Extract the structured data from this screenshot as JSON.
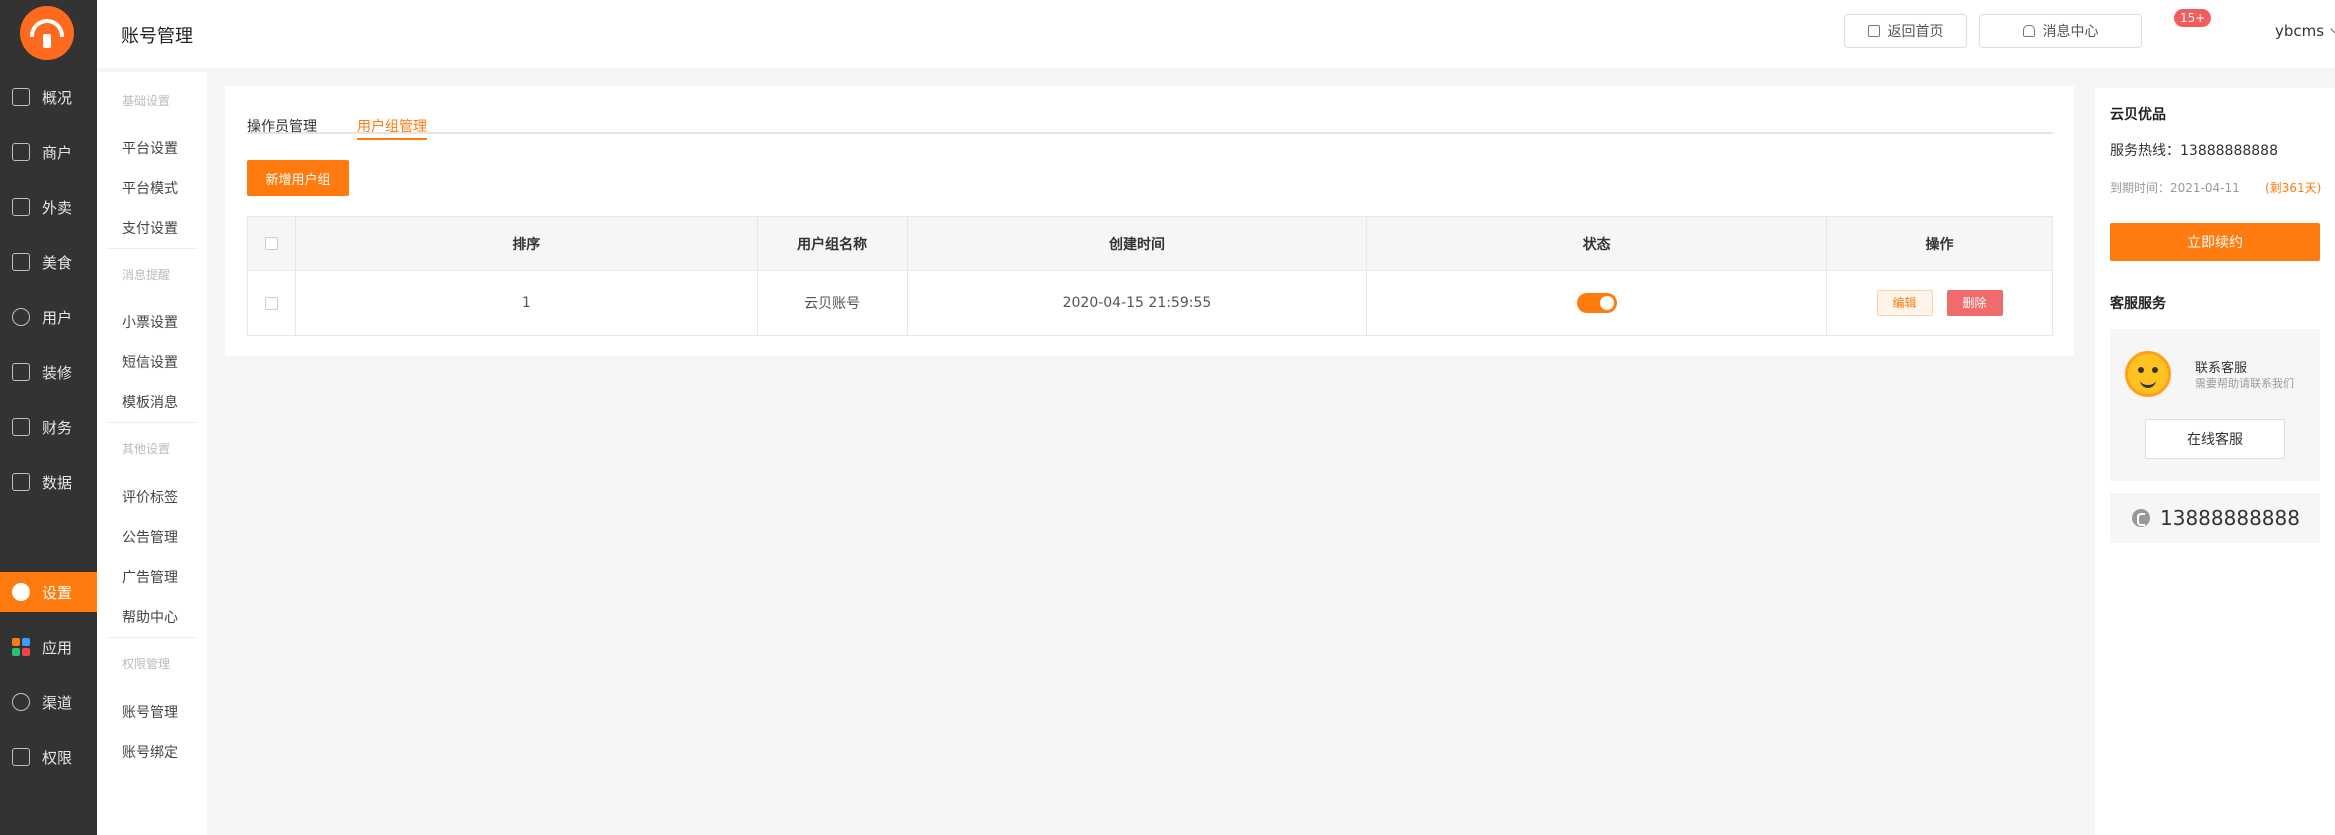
{
  "sidebar": {
    "items": [
      {
        "label": "概况",
        "icon": "home-icon"
      },
      {
        "label": "商户",
        "icon": "store-icon"
      },
      {
        "label": "外卖",
        "icon": "document-icon"
      },
      {
        "label": "美食",
        "icon": "menu-icon"
      },
      {
        "label": "用户",
        "icon": "user-icon"
      },
      {
        "label": "装修",
        "icon": "paint-icon"
      },
      {
        "label": "财务",
        "icon": "wallet-icon"
      },
      {
        "label": "数据",
        "icon": "chart-icon"
      },
      {
        "label": "设置",
        "icon": "gear-icon",
        "active": true
      },
      {
        "label": "应用",
        "icon": "apps-icon"
      },
      {
        "label": "渠道",
        "icon": "link-icon"
      },
      {
        "label": "权限",
        "icon": "lock-icon"
      }
    ]
  },
  "header": {
    "title": "账号管理",
    "home_label": "返回首页",
    "message_label": "消息中心",
    "message_badge": "15+",
    "username": "ybcms"
  },
  "submenu": {
    "group1": "基础设置",
    "g1_items": [
      "平台设置",
      "平台模式",
      "支付设置"
    ],
    "group2": "消息提醒",
    "g2_items": [
      "小票设置",
      "短信设置",
      "模板消息"
    ],
    "group3": "其他设置",
    "g3_items": [
      "评价标签",
      "公告管理",
      "广告管理",
      "帮助中心"
    ],
    "group4": "权限管理",
    "g4_items": [
      "账号管理",
      "账号绑定"
    ]
  },
  "main": {
    "tabs": [
      "操作员管理",
      "用户组管理"
    ],
    "active_tab": "用户组管理",
    "add_label": "新增用户组",
    "columns": [
      "排序",
      "用户组名称",
      "创建时间",
      "状态",
      "操作"
    ],
    "rows": [
      {
        "order": "1",
        "name": "云贝账号",
        "created": "2020-04-15 21:59:55",
        "status_on": true,
        "edit": "编辑",
        "delete": "删除"
      }
    ]
  },
  "right": {
    "title": "云贝优品",
    "hotline": "服务热线：13888888888",
    "expire": "到期时间：2021-04-11",
    "remain": "(剩361天)",
    "renew_label": "立即续约",
    "service_title": "客服服务",
    "cs_name": "联系客服",
    "cs_tip": "需要帮助请联系我们",
    "cs_button": "在线客服",
    "phone": "13888888888"
  },
  "colors": {
    "accent": "#ff7b0f",
    "sidebar_bg": "#333333",
    "danger": "#f06c6c"
  }
}
